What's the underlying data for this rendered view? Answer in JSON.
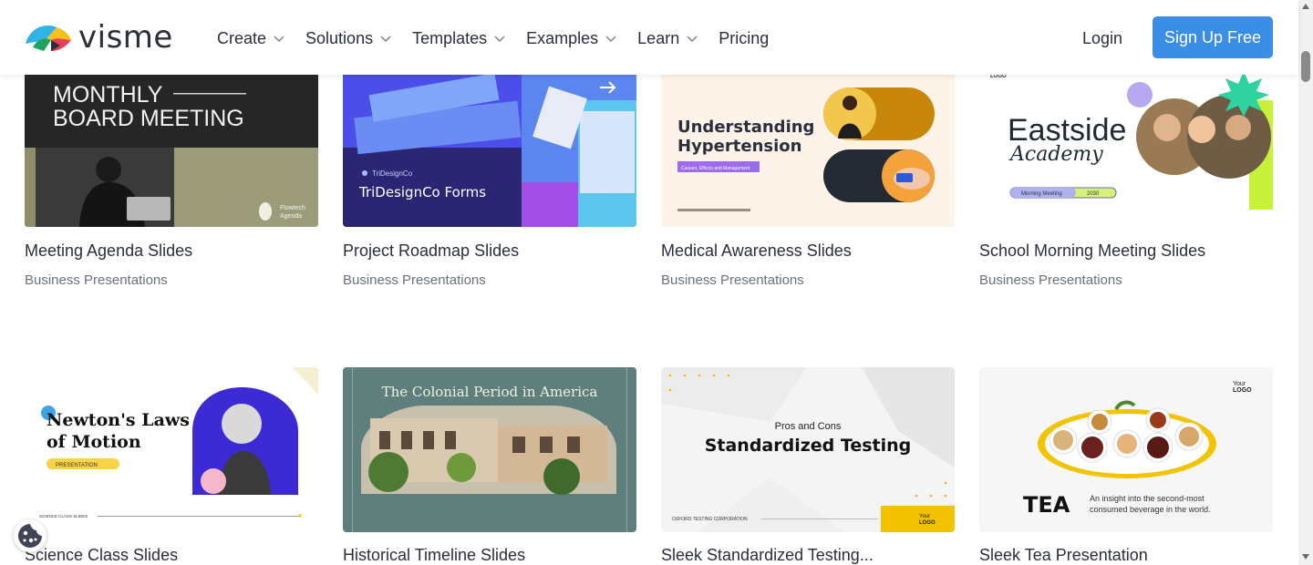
{
  "brand": {
    "name": "visme"
  },
  "nav": {
    "items": [
      {
        "label": "Create",
        "dropdown": true
      },
      {
        "label": "Solutions",
        "dropdown": true
      },
      {
        "label": "Templates",
        "dropdown": true
      },
      {
        "label": "Examples",
        "dropdown": true
      },
      {
        "label": "Learn",
        "dropdown": true
      },
      {
        "label": "Pricing",
        "dropdown": false
      }
    ],
    "login": "Login",
    "signup": "Sign Up Free"
  },
  "colors": {
    "accent": "#3a8ee6",
    "text": "#2b2e3b",
    "muted": "#6c707a"
  },
  "cards": [
    {
      "title": "Meeting Agenda Slides",
      "category": "Business Presentations",
      "thumb": {
        "line1": "MONTHLY",
        "line2": "BOARD MEETING",
        "caption1": "Flowtech",
        "caption2": "Agenda"
      }
    },
    {
      "title": "Project Roadmap Slides",
      "category": "Business Presentations",
      "thumb": {
        "brand": "TriDesignCo",
        "heading": "TriDesignCo Forms"
      }
    },
    {
      "title": "Medical Awareness Slides",
      "category": "Business Presentations",
      "thumb": {
        "line1": "Understanding",
        "line2": "Hypertension",
        "tag": "Causes, Effects and Management"
      }
    },
    {
      "title": "School Morning Meeting Slides",
      "category": "Business Presentations",
      "thumb": {
        "line1": "Eastside",
        "line2": "Academy",
        "pill": "Morning Meeting",
        "year": "2030",
        "logo": "LOGO"
      }
    },
    {
      "title": "Science Class Slides",
      "category": "",
      "thumb": {
        "line1": "Newton's Laws",
        "line2": "of Motion",
        "tag": "PRESENTATION",
        "footer": "SCIENCE CLASS SLIDES"
      }
    },
    {
      "title": "Historical Timeline Slides",
      "category": "",
      "thumb": {
        "heading": "The Colonial Period in America"
      }
    },
    {
      "title": "Sleek Standardized Testing...",
      "category": "",
      "thumb": {
        "kicker": "Pros and Cons",
        "heading": "Standardized Testing",
        "footer": "OXFORD TESTING CORPORATION",
        "logo1": "Your",
        "logo2": "LOGO"
      }
    },
    {
      "title": "Sleek Tea Presentation",
      "category": "",
      "thumb": {
        "heading": "TEA",
        "text1": "An insight into the second-most",
        "text2": "consumed beverage in the world.",
        "logo1": "Your",
        "logo2": "LOGO"
      }
    }
  ]
}
